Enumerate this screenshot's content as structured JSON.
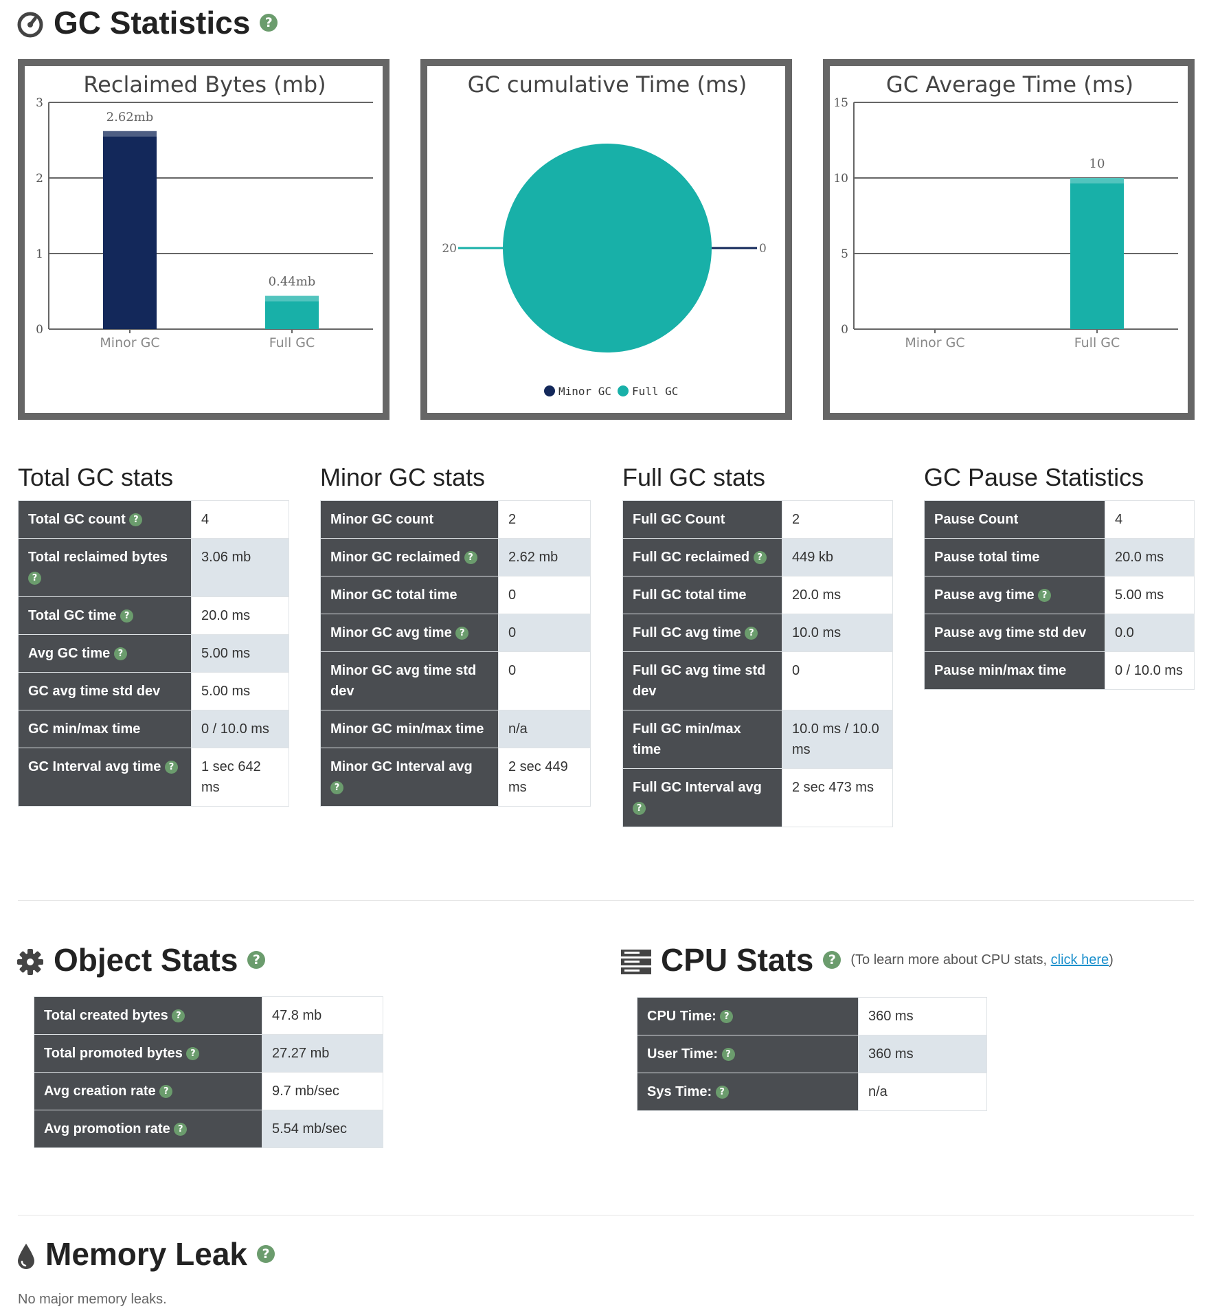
{
  "gc_statistics": {
    "title": "GC Statistics"
  },
  "charts": {
    "reclaimed": {
      "title": "Reclaimed Bytes (mb)",
      "categories": [
        "Minor GC",
        "Full GC"
      ],
      "values": [
        2.62,
        0.44
      ],
      "labels": [
        "2.62mb",
        "0.44mb"
      ],
      "yticks": [
        "0",
        "1",
        "2",
        "3"
      ],
      "colors": [
        "#13285a",
        "#18b0a8"
      ]
    },
    "cumulative": {
      "title": "GC cumulative Time (ms)",
      "labels": [
        "20",
        "0"
      ],
      "legend": [
        "Minor GC",
        "Full GC"
      ],
      "colors": [
        "#13285a",
        "#18b0a8"
      ]
    },
    "average": {
      "title": "GC Average Time (ms)",
      "categories": [
        "Minor GC",
        "Full GC"
      ],
      "values": [
        0,
        10
      ],
      "label": "10",
      "yticks": [
        "0",
        "5",
        "10",
        "15"
      ],
      "color": "#18b0a8"
    }
  },
  "chart_data": [
    {
      "type": "bar",
      "title": "Reclaimed Bytes (mb)",
      "categories": [
        "Minor GC",
        "Full GC"
      ],
      "values": [
        2.62,
        0.44
      ],
      "data_labels": [
        "2.62mb",
        "0.44mb"
      ],
      "ylim": [
        0,
        3
      ],
      "grid": true
    },
    {
      "type": "pie",
      "title": "GC cumulative Time (ms)",
      "categories": [
        "Minor GC",
        "Full GC"
      ],
      "values": [
        20,
        0
      ],
      "legend": "bottom"
    },
    {
      "type": "bar",
      "title": "GC Average Time (ms)",
      "categories": [
        "Minor GC",
        "Full GC"
      ],
      "values": [
        0,
        10
      ],
      "ylim": [
        0,
        15
      ],
      "grid": true
    }
  ],
  "total_gc": {
    "title": "Total GC stats",
    "rows": [
      {
        "k": "Total GC count",
        "v": "4"
      },
      {
        "k": "Total reclaimed bytes",
        "v": "3.06 mb"
      },
      {
        "k": "Total GC time",
        "v": "20.0 ms"
      },
      {
        "k": "Avg GC time",
        "v": "5.00 ms"
      },
      {
        "k": "GC avg time std dev",
        "v": "5.00 ms"
      },
      {
        "k": "GC min/max time",
        "v": "0 / 10.0 ms"
      },
      {
        "k": "GC Interval avg time",
        "v": "1 sec 642 ms"
      }
    ]
  },
  "minor_gc": {
    "title": "Minor GC stats",
    "rows": [
      {
        "k": "Minor GC count",
        "v": "2"
      },
      {
        "k": "Minor GC reclaimed",
        "v": "2.62 mb"
      },
      {
        "k": "Minor GC total time",
        "v": "0"
      },
      {
        "k": "Minor GC avg time",
        "v": "0"
      },
      {
        "k": "Minor GC avg time std dev",
        "v": "0"
      },
      {
        "k": "Minor GC min/max time",
        "v": "n/a"
      },
      {
        "k": "Minor GC Interval avg",
        "v": "2 sec 449 ms"
      }
    ]
  },
  "full_gc": {
    "title": "Full GC stats",
    "rows": [
      {
        "k": "Full GC Count",
        "v": "2"
      },
      {
        "k": "Full GC reclaimed",
        "v": "449 kb"
      },
      {
        "k": "Full GC total time",
        "v": "20.0 ms"
      },
      {
        "k": "Full GC avg time",
        "v": "10.0 ms"
      },
      {
        "k": "Full GC avg time std dev",
        "v": "0"
      },
      {
        "k": "Full GC min/max time",
        "v": "10.0 ms / 10.0 ms"
      },
      {
        "k": "Full GC Interval avg",
        "v": "2 sec 473 ms"
      }
    ]
  },
  "pause": {
    "title": "GC Pause Statistics",
    "rows": [
      {
        "k": "Pause Count",
        "v": "4"
      },
      {
        "k": "Pause total time",
        "v": "20.0 ms"
      },
      {
        "k": "Pause avg time",
        "v": "5.00 ms"
      },
      {
        "k": "Pause avg time std dev",
        "v": "0.0"
      },
      {
        "k": "Pause min/max time",
        "v": "0 / 10.0 ms"
      }
    ]
  },
  "object_stats": {
    "title": "Object Stats",
    "rows": [
      {
        "k": "Total created bytes",
        "v": "47.8 mb"
      },
      {
        "k": "Total promoted bytes",
        "v": "27.27 mb"
      },
      {
        "k": "Avg creation rate",
        "v": "9.7 mb/sec"
      },
      {
        "k": "Avg promotion rate",
        "v": "5.54 mb/sec"
      }
    ]
  },
  "cpu_stats": {
    "title": "CPU Stats",
    "note_prefix": "(To learn more about CPU stats, ",
    "note_link": "click here",
    "note_suffix": ")",
    "rows": [
      {
        "k": "CPU Time:",
        "v": "360 ms"
      },
      {
        "k": "User Time:",
        "v": "360 ms"
      },
      {
        "k": "Sys Time:",
        "v": "n/a"
      }
    ]
  },
  "memory_leak": {
    "title": "Memory Leak",
    "message": "No major memory leaks."
  },
  "icons": {
    "help": "?",
    "gc": "gauge-icon",
    "object": "gear-icon",
    "cpu": "server-icon",
    "leak": "drop-icon"
  }
}
